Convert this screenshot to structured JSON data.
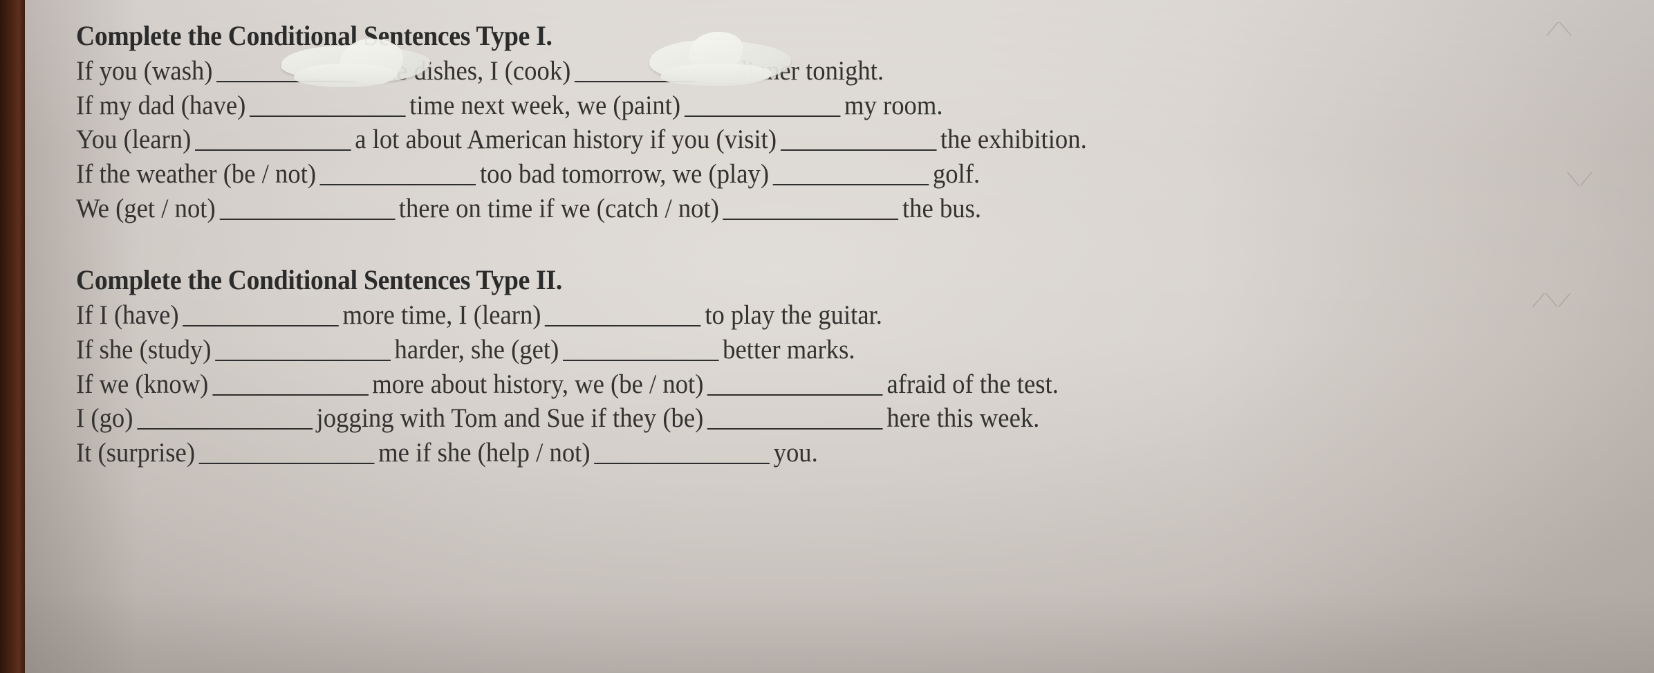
{
  "document": {
    "kind": "printed English grammar worksheet photograph",
    "paper_color": "#d7d2cd",
    "ink_color": "#303030",
    "desk_color": "#4a2314"
  },
  "sections": [
    {
      "heading": "Complete the Conditional Sentences Type I.",
      "sentences": [
        {
          "parts": [
            "If you (wash)",
            "the dishes, I (cook)",
            "dinner tonight."
          ],
          "whiteout": true
        },
        {
          "parts": [
            "If my dad (have)",
            "time next week, we (paint)",
            "my room."
          ],
          "whiteout": false
        },
        {
          "parts": [
            "You (learn)",
            "a lot about American history if you (visit)",
            "the exhibition."
          ],
          "whiteout": false
        },
        {
          "parts": [
            "If the weather (be / not)",
            "too bad tomorrow, we (play)",
            "golf."
          ],
          "whiteout": false
        },
        {
          "parts": [
            "We (get / not)",
            "there on time if we (catch / not)",
            "the bus."
          ],
          "whiteout": false
        }
      ]
    },
    {
      "heading": "Complete the Conditional Sentences Type II.",
      "sentences": [
        {
          "parts": [
            "If I (have)",
            "more time, I (learn)",
            "to play the guitar."
          ],
          "whiteout": false
        },
        {
          "parts": [
            "If she (study)",
            "harder, she (get)",
            "better marks."
          ],
          "whiteout": false
        },
        {
          "parts": [
            "If we (know)",
            "more about history, we (be / not)",
            "afraid of the test."
          ],
          "whiteout": false
        },
        {
          "parts": [
            "I (go)",
            "jogging with Tom and Sue if they (be)",
            "here this week."
          ],
          "whiteout": false
        },
        {
          "parts": [
            "It (surprise)",
            "me if she (help / not)",
            "you."
          ],
          "whiteout": false
        }
      ]
    }
  ]
}
